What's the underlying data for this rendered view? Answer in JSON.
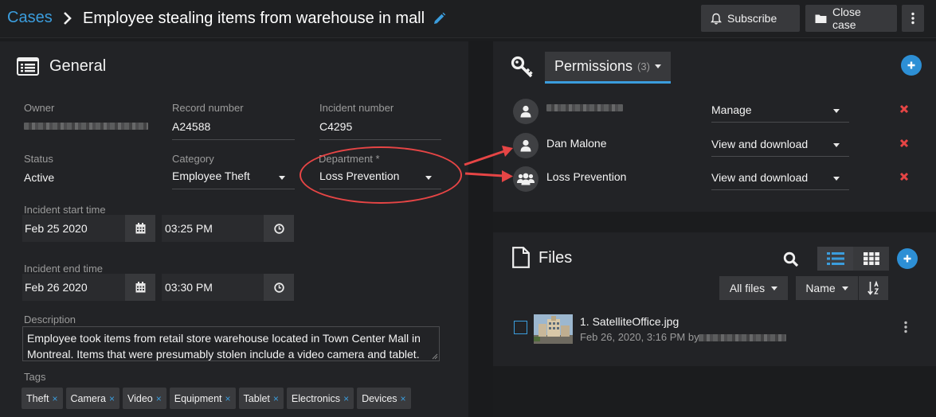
{
  "header": {
    "breadcrumb_root": "Cases",
    "case_title": "Employee stealing items from warehouse in mall",
    "subscribe_label": "Subscribe",
    "close_case_label": "Close case"
  },
  "general": {
    "title": "General",
    "owner_label": "Owner",
    "record_label": "Record number",
    "record_value": "A24588",
    "incident_label": "Incident number",
    "incident_value": "C4295",
    "status_label": "Status",
    "status_value": "Active",
    "category_label": "Category",
    "category_value": "Employee Theft",
    "department_label": "Department *",
    "department_value": "Loss Prevention",
    "start_label": "Incident start time",
    "start_date": "Feb 25 2020",
    "start_time": "03:25 PM",
    "end_label": "Incident end time",
    "end_date": "Feb 26 2020",
    "end_time": "03:30 PM",
    "description_label": "Description",
    "description_line1": "Employee took items from retail store warehouse located in Town Center Mall in",
    "description_line2": "Montreal. Items that were presumably stolen include a video camera and tablet.",
    "tags_label": "Tags",
    "tags": [
      "Theft",
      "Camera",
      "Video",
      "Equipment",
      "Tablet",
      "Electronics",
      "Devices"
    ],
    "tag_remove": "×"
  },
  "permissions": {
    "tab_label": "Permissions",
    "count": "(3)",
    "entries": [
      {
        "name": "",
        "access": "Manage"
      },
      {
        "name": "Dan Malone",
        "access": "View and download"
      },
      {
        "name": "Loss Prevention",
        "access": "View and download"
      }
    ]
  },
  "files": {
    "title": "Files",
    "filter_label": "All files",
    "sort_label": "Name",
    "items": [
      {
        "name": "1. SatelliteOffice.jpg",
        "meta": "Feb 26, 2020, 3:16 PM by"
      }
    ]
  },
  "colors": {
    "accent": "#3b9ddd",
    "annotation": "#e64545",
    "delete": "#e64545"
  }
}
